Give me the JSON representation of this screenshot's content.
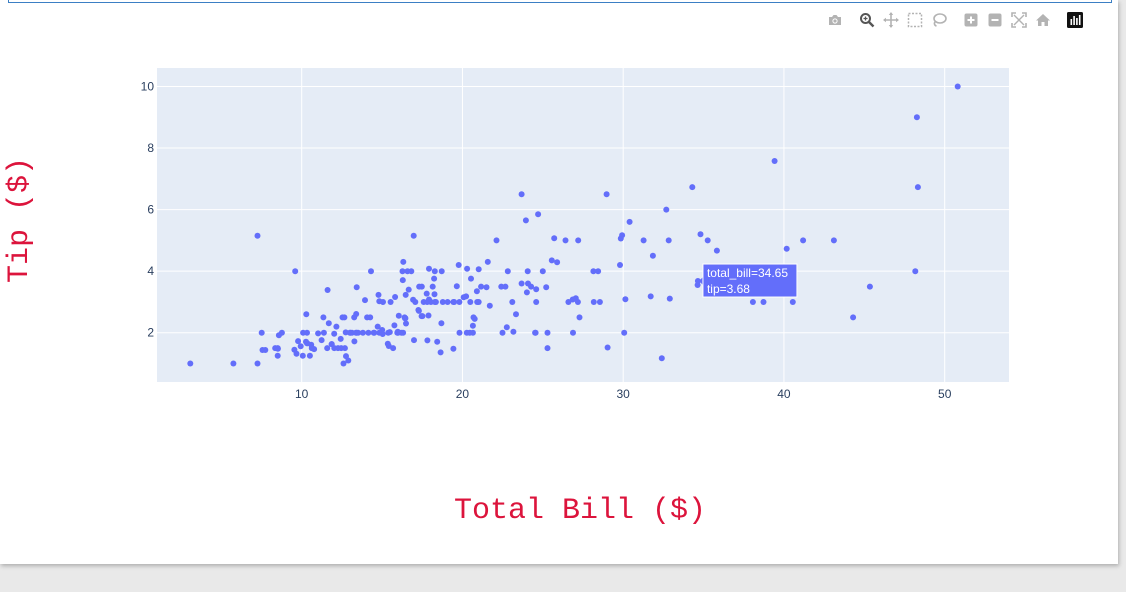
{
  "toolbar": {
    "buttons": [
      {
        "name": "camera-icon",
        "title": "Download plot as a png"
      },
      {
        "name": "zoom-icon",
        "title": "Zoom"
      },
      {
        "name": "pan-icon",
        "title": "Pan"
      },
      {
        "name": "box-select-icon",
        "title": "Box Select"
      },
      {
        "name": "lasso-select-icon",
        "title": "Lasso Select"
      },
      {
        "name": "zoom-in-icon",
        "title": "Zoom in"
      },
      {
        "name": "zoom-out-icon",
        "title": "Zoom out"
      },
      {
        "name": "autoscale-icon",
        "title": "Autoscale"
      },
      {
        "name": "reset-axes-icon",
        "title": "Reset axes"
      },
      {
        "name": "plotly-logo-icon",
        "title": "Produced with Plotly"
      }
    ]
  },
  "chart_data": {
    "type": "scatter",
    "title": "",
    "xlabel": "Total Bill ($)",
    "ylabel": "Tip ($)",
    "xlim": [
      1.0,
      54.0
    ],
    "ylim": [
      0.4,
      10.6
    ],
    "xticks": [
      10,
      20,
      30,
      40,
      50
    ],
    "yticks": [
      2,
      4,
      6,
      8,
      10
    ],
    "grid": true,
    "marker_color": "#636efa",
    "plot_bg": "#e5ecf6",
    "axis_title_color": "#dc143c",
    "series": [
      {
        "x": [
          3.07,
          5.75,
          7.25,
          7.25,
          7.51,
          7.56,
          7.74,
          8.35,
          8.51,
          8.52,
          8.58,
          8.77,
          9.55,
          9.6,
          9.68,
          9.94,
          10.07,
          10.09,
          10.27,
          10.29,
          10.33,
          10.34,
          10.51,
          10.59,
          10.63,
          10.65,
          10.77,
          11.02,
          11.24,
          11.35,
          11.38,
          11.59,
          11.61,
          11.69,
          11.87,
          12.02,
          12.03,
          12.16,
          12.26,
          12.43,
          12.46,
          12.54,
          12.6,
          12.66,
          12.69,
          12.74,
          12.76,
          12.9,
          13.0,
          13.03,
          13.13,
          13.27,
          13.28,
          13.37,
          13.39,
          13.42,
          13.51,
          13.81,
          13.94,
          14.07,
          14.15,
          14.26,
          14.31,
          14.48,
          14.52,
          14.73,
          14.78,
          14.83,
          15.01,
          15.04,
          15.06,
          15.36,
          15.38,
          15.42,
          15.48,
          15.53,
          15.69,
          15.77,
          15.81,
          15.95,
          15.98,
          16.0,
          16.04,
          16.21,
          16.27,
          16.29,
          16.31,
          16.32,
          16.4,
          16.45,
          16.47,
          16.49,
          16.58,
          16.66,
          16.82,
          16.93,
          16.97,
          16.99,
          17.07,
          17.26,
          17.29,
          17.31,
          17.46,
          17.47,
          17.51,
          17.59,
          17.78,
          17.81,
          17.82,
          17.89,
          17.92,
          18.04,
          18.15,
          18.24,
          18.28,
          18.29,
          18.35,
          18.43,
          18.64,
          18.69,
          18.71,
          18.78,
          19.08,
          19.44,
          19.49,
          19.65,
          19.77,
          19.81,
          19.82,
          20.08,
          20.23,
          20.27,
          20.29,
          20.45,
          20.49,
          20.53,
          20.65,
          20.69,
          20.76,
          20.9,
          20.92,
          21.01,
          21.16,
          21.5,
          21.58,
          21.7,
          22.12,
          22.42,
          22.49,
          22.67,
          22.76,
          22.82,
          23.1,
          23.17,
          23.33,
          23.68,
          23.95,
          24.01,
          24.06,
          24.08,
          24.27,
          24.52,
          24.55,
          24.59,
          24.71,
          25.0,
          25.21,
          25.29,
          25.56,
          25.71,
          25.89,
          26.41,
          26.59,
          26.86,
          26.88,
          27.05,
          27.18,
          27.2,
          27.28,
          28.15,
          28.17,
          28.44,
          28.55,
          28.97,
          29.03,
          29.8,
          29.85,
          29.93,
          30.06,
          30.14,
          30.4,
          31.27,
          31.71,
          31.85,
          32.4,
          32.68,
          32.83,
          32.9,
          34.3,
          34.63,
          34.65,
          34.81,
          35.26,
          35.83,
          38.07,
          38.73,
          39.42,
          40.17,
          40.55,
          41.19,
          43.11,
          44.3,
          45.35,
          48.17,
          48.27,
          48.33,
          50.81,
          9.78,
          10.34,
          11.87,
          13.42,
          16.43,
          17.92,
          18.26,
          19.44,
          21.01,
          23.68,
          24.59,
          25.29,
          8.51,
          14.83,
          20.65
        ],
        "y": [
          1.0,
          1.0,
          1.0,
          5.15,
          2.0,
          1.44,
          1.44,
          1.5,
          1.25,
          1.48,
          1.92,
          2.0,
          1.45,
          4.0,
          1.32,
          1.56,
          1.25,
          2.0,
          1.71,
          2.6,
          2.0,
          1.66,
          1.25,
          1.61,
          1.5,
          1.5,
          1.47,
          1.98,
          1.76,
          2.5,
          2.0,
          1.5,
          3.39,
          2.31,
          1.63,
          1.97,
          1.5,
          2.2,
          1.5,
          1.8,
          1.5,
          2.5,
          1.0,
          2.5,
          1.5,
          2.01,
          1.24,
          1.1,
          2.0,
          2.0,
          2.0,
          2.5,
          1.72,
          2.0,
          2.61,
          3.48,
          2.0,
          2.0,
          3.06,
          2.5,
          2.0,
          2.5,
          4.0,
          2.0,
          2.0,
          2.2,
          3.23,
          3.02,
          2.09,
          1.96,
          3.0,
          1.64,
          2.0,
          1.57,
          2.02,
          3.0,
          1.5,
          2.24,
          3.16,
          2.0,
          2.03,
          2.0,
          2.55,
          2.0,
          4.0,
          3.71,
          2.0,
          4.3,
          2.5,
          2.47,
          3.23,
          2.3,
          4.0,
          3.4,
          4.0,
          3.07,
          5.15,
          1.76,
          3.0,
          2.74,
          2.71,
          3.5,
          2.54,
          3.5,
          2.54,
          3.0,
          3.27,
          3.0,
          1.75,
          2.56,
          4.08,
          3.0,
          3.5,
          3.76,
          4.0,
          3.0,
          3.0,
          1.71,
          1.36,
          2.31,
          4.0,
          3.0,
          3.0,
          1.48,
          3.0,
          3.51,
          4.2,
          3.0,
          2.0,
          3.15,
          3.18,
          2.0,
          4.08,
          2.0,
          3.0,
          3.76,
          2.23,
          2.5,
          2.45,
          3.35,
          3.0,
          4.06,
          3.5,
          3.48,
          4.3,
          2.88,
          5.0,
          3.5,
          2.0,
          3.5,
          2.18,
          4.0,
          3.0,
          2.03,
          2.6,
          6.5,
          5.65,
          3.31,
          4.0,
          3.6,
          3.5,
          2.0,
          2.0,
          3.41,
          5.85,
          4.0,
          3.48,
          1.5,
          4.35,
          5.07,
          4.29,
          5.0,
          3.0,
          3.08,
          2.0,
          3.12,
          3.0,
          5.0,
          2.5,
          4.0,
          3.0,
          4.0,
          3.0,
          6.5,
          1.52,
          4.2,
          5.06,
          5.17,
          2.0,
          3.09,
          5.6,
          5.0,
          3.18,
          4.5,
          1.17,
          6.0,
          5.0,
          3.11,
          6.73,
          3.55,
          3.68,
          5.2,
          5.0,
          4.67,
          3.0,
          3.0,
          7.58,
          4.73,
          3.0,
          5.0,
          5.0,
          2.5,
          3.5,
          4.0,
          9.0,
          6.73,
          10.0,
          1.73,
          1.66,
          1.63,
          2.0,
          2.47,
          3.08,
          3.25,
          3.0,
          3.0,
          3.6,
          3.0,
          2.0,
          1.5,
          2.0,
          2.0
        ]
      }
    ],
    "hover": {
      "x": 34.65,
      "y": 3.68,
      "line1": "total_bill=34.65",
      "line2": "tip=3.68"
    }
  }
}
